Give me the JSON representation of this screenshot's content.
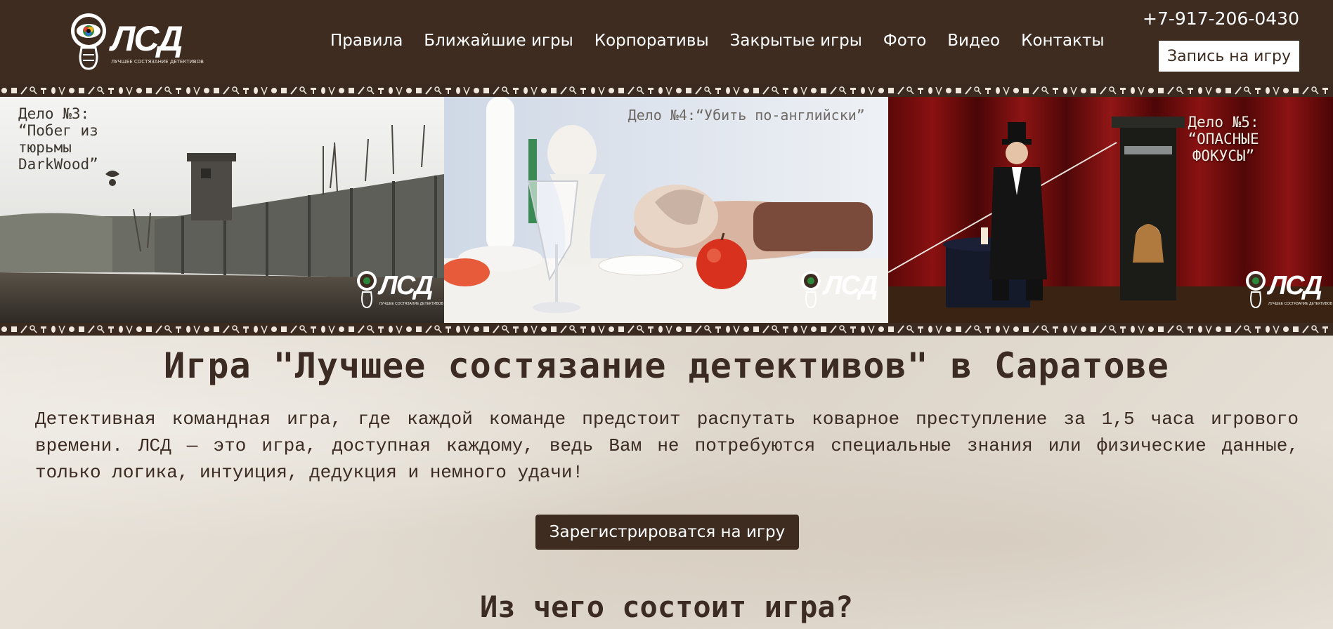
{
  "header": {
    "logo_text": "ЛСД",
    "logo_tagline": "ЛУЧШЕЕ СОСТЯЗАНИЕ ДЕТЕКТИВОВ",
    "nav": [
      "Правила",
      "Ближайшие игры",
      "Корпоративы",
      "Закрытые игры",
      "Фото",
      "Видео",
      "Контакты"
    ],
    "phone": "+7-917-206-0430",
    "signup_label": "Запись на игру"
  },
  "banner": {
    "panels": [
      {
        "title": "Дело №3:\n“Побег из\nтюрьмы\nDarkWood”"
      },
      {
        "title": "Дело №4:“Убить по-английски”"
      },
      {
        "title": "Дело №5:\n“ОПАСНЫЕ\nФОКУСЫ”"
      }
    ],
    "watermark": "ЛСД",
    "watermark_tagline": "ЛУЧШЕЕ СОСТЯЗАНИЕ ДЕТЕКТИВОВ"
  },
  "content": {
    "title": "Игра \"Лучшее состязание детективов\" в Саратове",
    "description": "Детективная командная игра, где каждой команде предстоит распутать коварное преступление за 1,5 часа игрового времени. ЛСД — это игра, доступная каждому, ведь Вам не потребуются специальные знания или физические данные, только логика, интуиция, дедукция и немного удачи!",
    "register_label": "Зарегистрироватся на игру",
    "subtitle": "Из чего состоит игра?"
  },
  "colors": {
    "brand_dark": "#3e2c21",
    "paper": "#e9e3da",
    "text": "#3b2b22"
  }
}
